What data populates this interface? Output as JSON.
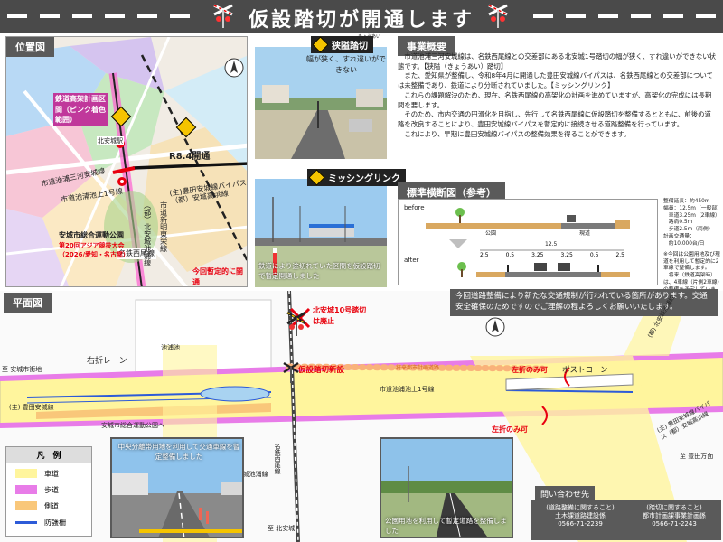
{
  "header": {
    "title": "仮設踏切が開通します"
  },
  "location_map": {
    "tag": "位置図",
    "labels": {
      "rail_plan": "鉄道高架計画区間（ピンク着色範囲）",
      "r84": "R8.4開通",
      "today_note": "今回暫定的に開通",
      "route_upper": "市道池浦三河安城線",
      "route_upper2": "市道池浦池上1号線",
      "route_main": "(主)豊田安城線バイパス",
      "route_main2": "（都）安城高浜線",
      "meitetsu": "名鉄西尾線",
      "route_kita": "（都）北安城池浦線",
      "route_kita2": "市道新明東栄線",
      "park": "安城市総合運動公園",
      "asian_games": "第20回アジア競技大会（2026/愛知・名古屋）",
      "takiwa": "北安城駅"
    }
  },
  "photo1": {
    "warn": "狭隘踏切",
    "ruby": "きょうあい",
    "note": "幅が狭く、すれ違いができない"
  },
  "photo2": {
    "warn": "ミッシングリンク",
    "note": "鉄道により途切れていた区間を仮設踏切で暫定開通しました"
  },
  "outline": {
    "tag": "事業概要",
    "paragraphs": [
      "市道池浦三河安城線は、名鉄西尾線との交差部にある北安城1号踏切の幅が狭く、すれ違いができない状態です。【狭隘（きょうあい）踏切】",
      "また、愛知県が整備し、令和8年4月に開通した豊田安城線バイパスは、名鉄西尾線との交差部については未整備であり、鉄道により分断されていました。【ミッシングリンク】",
      "これらの課題解決のため、現在、名鉄西尾線の高架化の計画を進めていますが、高架化の完成には長期間を要します。",
      "そのため、市内交通の円滑化を目指し、先行して名鉄西尾線に仮設踏切を整備するとともに、前後の道路を改良することにより、豊田安城線バイパスを暫定的に接続させる道路整備を行っています。",
      "これにより、早期に豊田安城線バイパスの整備効果を得ることができます。"
    ]
  },
  "cross_section": {
    "tag": "標準横断図（参考）",
    "before": "before",
    "after": "after",
    "park": "公園",
    "road": "現道",
    "total_width": "12.5",
    "dims": [
      "2.5",
      "0.5",
      "3.25",
      "3.25",
      "0.5",
      "2.5"
    ],
    "specs": [
      "整備延長：約450m",
      "幅員：12.5m（一般部）",
      "　車道3.25m（2車線）",
      "　路肩0.5m",
      "　歩道2.5m（両側）",
      "計画交通量：",
      "　約10,000台/日",
      "",
      "※今回は公園用地及び現道を利用して暫定的に2車線で整備します。",
      "　将来（鉄道高架時）は、4車線（片側2車線）の整備を予定しています。"
    ]
  },
  "plan": {
    "tag": "平面図",
    "notice": "今回道路整備により新たな交通規制が行われている箇所があります。交通安全確保のためですのでご理解の程よろしくお願いいたします。",
    "labels": {
      "abolish": "北安城10号踏切は廃止",
      "new_crossing": "仮設踏切新設",
      "future": "将来都市計画道路",
      "right_lane": "右折レーン",
      "post_cone": "ポストコーン",
      "left_only1": "左折のみ可",
      "left_only2": "左折のみ可",
      "to_anjo": "至 安城市街地",
      "to_kita": "至 北安城",
      "route_main": "(主) 豊田安城線",
      "park": "安城市総合運動公園へ",
      "ikeura": "市道池浦池上1号線",
      "meitetsu": "名鉄西尾線",
      "kita_line": "(都) 北安城池浦線",
      "anjo_takahama": "(主) 豊田安城線バイパス（都）安城高浜線",
      "pond": "池浦池",
      "kita_ikeura": "(都) 北安城池浦線",
      "to_toyota": "至 豊田方面"
    },
    "photo_a": "中央分離帯用地を利用して交通車線を暫定整備しました",
    "photo_b": "公園用地を利用して暫定道路を整備しました"
  },
  "legend": {
    "title": "凡　例",
    "items": [
      {
        "label": "車道",
        "color": "#fff59d"
      },
      {
        "label": "歩道",
        "color": "#e87ce8"
      },
      {
        "label": "側道",
        "color": "#f9c77a"
      },
      {
        "label": "防護柵",
        "color": "#2d5bd8"
      }
    ]
  },
  "contact": {
    "title": "問い合わせ先",
    "col1": {
      "subject": "(道路整備に関すること)",
      "office": "土木課道路建設係",
      "tel": "0566-71-2239"
    },
    "col2": {
      "subject": "(踏切に関すること)",
      "office": "都市計画課事業計画係",
      "tel": "0566-71-2243"
    }
  }
}
